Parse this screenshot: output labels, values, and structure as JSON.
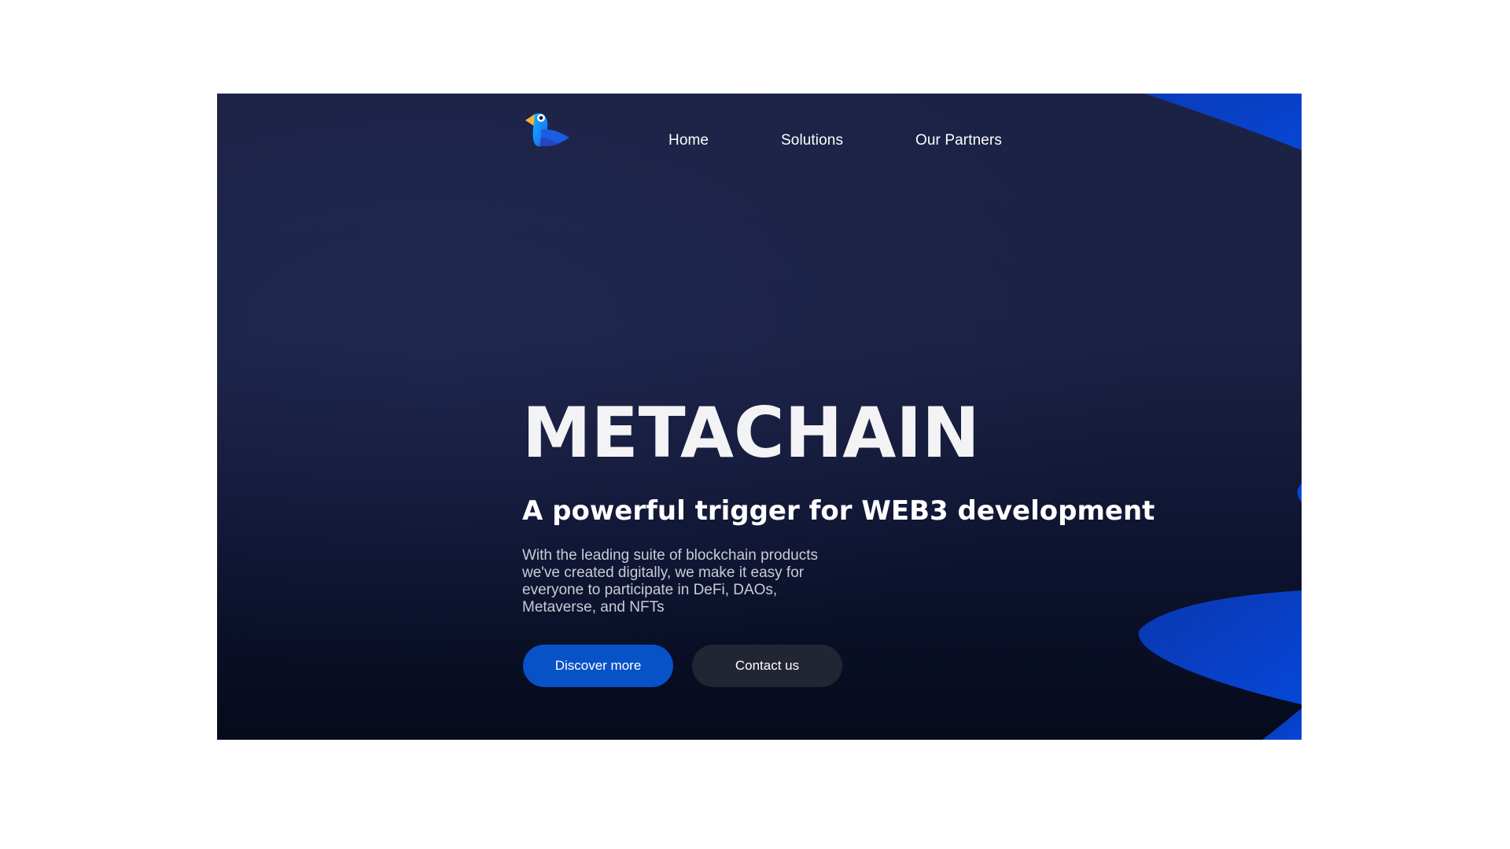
{
  "nav": {
    "logo_icon": "bird-logo-icon",
    "links": [
      {
        "label": "Home"
      },
      {
        "label": "Solutions"
      },
      {
        "label": "Our Partners"
      }
    ]
  },
  "hero": {
    "title": "METACHAIN",
    "subtitle": "A powerful trigger for WEB3 development",
    "description": "With the leading suite of blockchain products we've created digitally, we make it easy for everyone to participate in DeFi, DAOs, Metaverse, and NFTs",
    "primary_button": "Discover more",
    "secondary_button": "Contact us"
  },
  "colors": {
    "background": "#1c2244",
    "accent": "#0752c7",
    "secondary_button": "#222632",
    "text": "#ffffff"
  }
}
